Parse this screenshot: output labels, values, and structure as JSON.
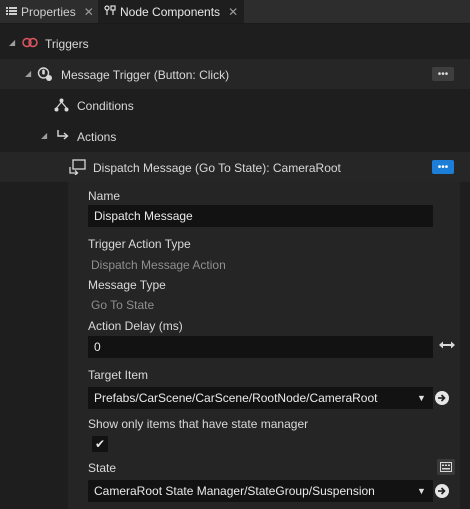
{
  "tabs": [
    {
      "label": "Properties",
      "close": "✕",
      "active": false
    },
    {
      "label": "Node Components",
      "close": "✕",
      "active": true
    }
  ],
  "tree": {
    "triggers": "Triggers",
    "message_trigger": "Message Trigger (Button: Click)",
    "conditions": "Conditions",
    "actions": "Actions",
    "dispatch": "Dispatch Message (Go To State): CameraRoot",
    "menu_glyph": "•••"
  },
  "props": {
    "name_label": "Name",
    "name_value": "Dispatch Message",
    "trigger_action_type_label": "Trigger Action Type",
    "trigger_action_type_value": "Dispatch Message Action",
    "message_type_label": "Message Type",
    "message_type_value": "Go To State",
    "action_delay_label": "Action Delay (ms)",
    "action_delay_value": "0",
    "target_item_label": "Target Item",
    "target_item_value": "Prefabs/CarScene/CarScene/RootNode/CameraRoot",
    "show_only_label": "Show only items that have state manager",
    "show_only_checked": true,
    "check_glyph": "✔",
    "state_label": "State",
    "state_value": "CameraRoot State Manager/StateGroup/Suspension"
  },
  "colors": {
    "accent": "#1c7ed6",
    "trigger_icon": "#e05561"
  }
}
